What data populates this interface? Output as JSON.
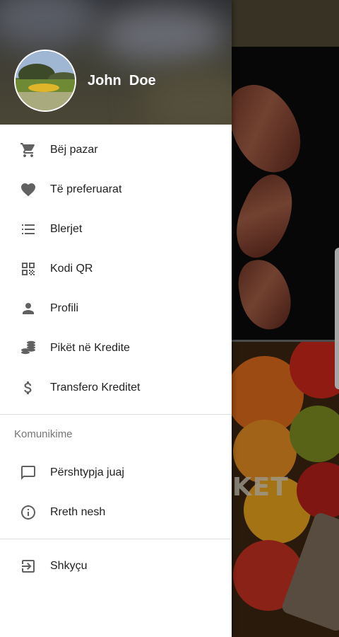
{
  "user": {
    "name": "John  Doe"
  },
  "menu": {
    "primary": [
      {
        "label": "Bëj pazar",
        "icon": "cart-icon"
      },
      {
        "label": "Të preferuarat",
        "icon": "heart-icon"
      },
      {
        "label": "Blerjet",
        "icon": "list-icon"
      },
      {
        "label": "Kodi QR",
        "icon": "qr-code-icon"
      },
      {
        "label": "Profili",
        "icon": "person-icon"
      },
      {
        "label": "Pikët në Kredite",
        "icon": "coins-icon"
      },
      {
        "label": "Transfero Kreditet",
        "icon": "dollar-icon"
      }
    ],
    "section_title": "Komunikime",
    "communication": [
      {
        "label": "Përshtypja juaj",
        "icon": "feedback-icon"
      },
      {
        "label": "Rreth nesh",
        "icon": "info-icon"
      }
    ],
    "logout": {
      "label": "Shkyçu",
      "icon": "logout-icon"
    }
  },
  "background": {
    "title_fragment": "RKET"
  },
  "colors": {
    "icon": "#616161",
    "text": "#212121",
    "section": "#757575",
    "header_bg": "#3f3e34"
  }
}
